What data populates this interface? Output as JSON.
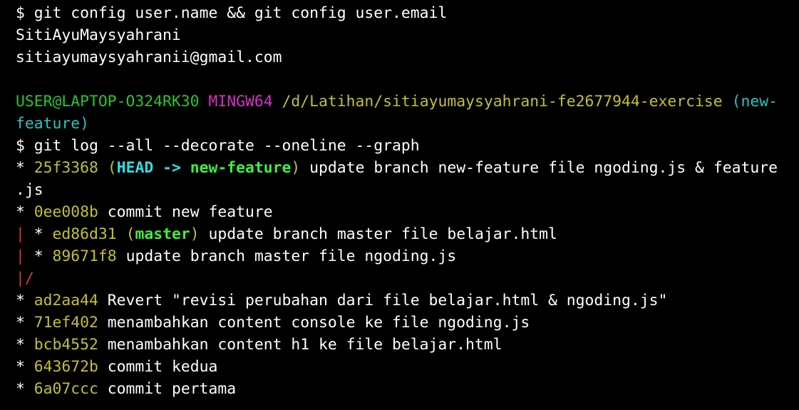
{
  "colors": {
    "background": "#000000",
    "text": "#ffffff",
    "commit_hash": "#c3c12c",
    "prompt_user": "#25c62e",
    "prompt_msystem": "#d630c8",
    "prompt_path": "#c3c12c",
    "prompt_branch": "#2bc3c3",
    "head_ref": "#2fe0e8",
    "branch_ref": "#3ef03e",
    "graph_branch_line": "#d53b3b"
  },
  "lines": [
    [
      {
        "text": "$ git config user.name && git config user.email",
        "color": "white"
      }
    ],
    [
      {
        "text": "SitiAyuMaysyahrani",
        "color": "white"
      }
    ],
    [
      {
        "text": "sitiayumaysyahranii@gmail.com",
        "color": "white"
      }
    ],
    [
      {
        "text": "",
        "color": "white"
      }
    ],
    [
      {
        "text": "USER@LAPTOP-O324RK30",
        "color": "green"
      },
      {
        "text": " ",
        "color": "white"
      },
      {
        "text": "MINGW64",
        "color": "magenta"
      },
      {
        "text": " ",
        "color": "white"
      },
      {
        "text": "/d/Latihan/sitiayumaysyahrani-fe2677944-exercise",
        "color": "path"
      },
      {
        "text": " ",
        "color": "white"
      },
      {
        "text": "(new-",
        "color": "cyan"
      }
    ],
    [
      {
        "text": "feature)",
        "color": "cyan"
      }
    ],
    [
      {
        "text": "$ git log --all --decorate --oneline --graph",
        "color": "white"
      }
    ],
    [
      {
        "text": "* ",
        "color": "white"
      },
      {
        "text": "25f3368",
        "color": "hash"
      },
      {
        "text": " ",
        "color": "white"
      },
      {
        "text": "(",
        "color": "hash"
      },
      {
        "text": "HEAD -> ",
        "color": "head"
      },
      {
        "text": "new-feature",
        "color": "branch"
      },
      {
        "text": ")",
        "color": "hash"
      },
      {
        "text": " update branch new-feature file ngoding.js & feature",
        "color": "white"
      }
    ],
    [
      {
        "text": ".js",
        "color": "white"
      }
    ],
    [
      {
        "text": "* ",
        "color": "white"
      },
      {
        "text": "0ee008b",
        "color": "hash"
      },
      {
        "text": " commit new feature",
        "color": "white"
      }
    ],
    [
      {
        "text": "|",
        "color": "graph-red"
      },
      {
        "text": " * ",
        "color": "white"
      },
      {
        "text": "ed86d31",
        "color": "hash"
      },
      {
        "text": " ",
        "color": "white"
      },
      {
        "text": "(",
        "color": "hash"
      },
      {
        "text": "master",
        "color": "branch"
      },
      {
        "text": ")",
        "color": "hash"
      },
      {
        "text": " update branch master file belajar.html",
        "color": "white"
      }
    ],
    [
      {
        "text": "|",
        "color": "graph-red"
      },
      {
        "text": " * ",
        "color": "white"
      },
      {
        "text": "89671f8",
        "color": "hash"
      },
      {
        "text": " update branch master file ngoding.js",
        "color": "white"
      }
    ],
    [
      {
        "text": "|",
        "color": "graph-red"
      },
      {
        "text": "/",
        "color": "graph-red"
      }
    ],
    [
      {
        "text": "* ",
        "color": "white"
      },
      {
        "text": "ad2aa44",
        "color": "hash"
      },
      {
        "text": " Revert \"revisi perubahan dari file belajar.html & ngoding.js\"",
        "color": "white"
      }
    ],
    [
      {
        "text": "* ",
        "color": "white"
      },
      {
        "text": "71ef402",
        "color": "hash"
      },
      {
        "text": " menambahkan content console ke file ngoding.js",
        "color": "white"
      }
    ],
    [
      {
        "text": "* ",
        "color": "white"
      },
      {
        "text": "bcb4552",
        "color": "hash"
      },
      {
        "text": " menambahkan content h1 ke file belajar.html",
        "color": "white"
      }
    ],
    [
      {
        "text": "* ",
        "color": "white"
      },
      {
        "text": "643672b",
        "color": "hash"
      },
      {
        "text": " commit kedua",
        "color": "white"
      }
    ],
    [
      {
        "text": "* ",
        "color": "white"
      },
      {
        "text": "6a07ccc",
        "color": "hash"
      },
      {
        "text": " commit pertama",
        "color": "white"
      }
    ]
  ]
}
